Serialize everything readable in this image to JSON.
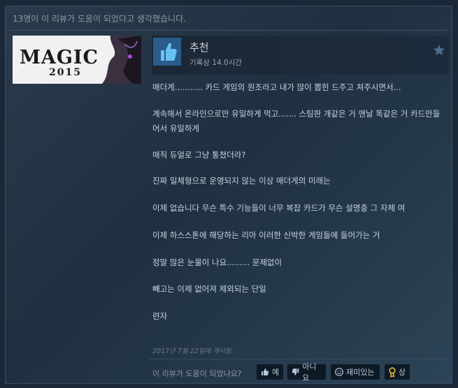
{
  "review": {
    "helpful_count_text": "13명이 이 리뷰가 도움이 되었다고 생각했습니다.",
    "game_logo_text": "MAGIC",
    "game_logo_year": "2015",
    "verdict": "추천",
    "playtime": "기록상 14.0시간",
    "paragraphs": [
      "매더게........... 카드 게임의 원조라고 내가 많이 뽑힌 드주고 쳐주시면서...",
      "계속해서 온라인으로만 유일하게 먹고....... 스팀판 개같은 거 맨날 똑같은 거 카드만들어서 유일하게",
      "매직 듀얼로 그냥 통쳤더라?",
      "진짜 일체형으로 운영되지 않는 이상 매더게의 미래는",
      "이제 없습니다 무슨 특수 기능들이 너무 복잡 카드가 무슨 설명충 그 자체 여",
      "이제 하스스톤에 해당하는 리아 이러한 신박한 게임들에 들어가는 거",
      "정말 많은 눈물이 나요......... 문제없이",
      "빼고는 이제 없어져 제외되는 단일",
      "련자"
    ],
    "posted_date": "2017년 7월 22일에 게시됨."
  },
  "vote": {
    "question": "이 리뷰가 도움이 되었나요?",
    "yes_label": "예",
    "no_label": "아니요",
    "funny_label": "재미있는",
    "award_label": "상"
  },
  "colors": {
    "background": "#1b2838",
    "accent_blue": "#67c1f5",
    "award_gold": "#e8b93a"
  },
  "icons": {
    "recommend": "thumbs-up-icon",
    "favorite": "star-icon",
    "yes": "thumbs-up-icon",
    "no": "thumbs-down-icon",
    "funny": "smiley-icon",
    "award": "award-icon"
  }
}
